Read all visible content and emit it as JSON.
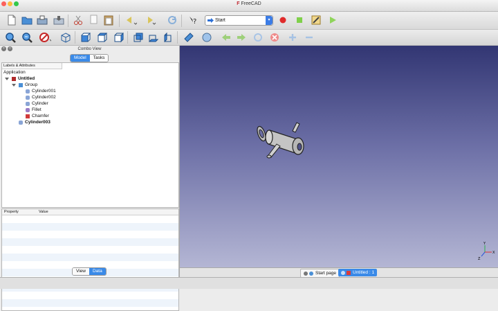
{
  "window": {
    "title": "FreeCAD",
    "controls": {
      "close_color": "#fc605b",
      "minimize_color": "#fdbc40",
      "zoom_color": "#34c84a"
    }
  },
  "toolbar": {
    "workbench": "Start",
    "icons_row1": [
      "new-file-icon",
      "open-folder-icon",
      "save-icon",
      "save-as-icon",
      "cut-icon",
      "copy-icon",
      "paste-icon",
      "undo-icon",
      "redo-icon",
      "refresh-icon",
      "whats-this-icon",
      "macro-record-icon",
      "macro-stop-icon",
      "macro-edit-icon",
      "macro-run-icon"
    ],
    "icons_row2": [
      "fit-all-icon",
      "fit-selection-icon",
      "draw-style-icon",
      "view-isometric-icon",
      "view-front-icon",
      "view-top-icon",
      "view-right-icon",
      "view-rear-icon",
      "view-bottom-icon",
      "view-left-icon",
      "measure-icon",
      "web-home-icon",
      "web-back-icon",
      "web-forward-icon",
      "web-refresh-icon",
      "web-stop-icon",
      "web-zoom-in-icon",
      "web-zoom-out-icon"
    ]
  },
  "combo_view": {
    "title": "Combo View",
    "tabs": [
      "Model",
      "Tasks"
    ],
    "active_tab": "Model",
    "labels_header": "Labels & Attributes",
    "application_label": "Application",
    "tree": [
      {
        "label": "Untitled",
        "level": 0,
        "bold": true,
        "icon": "document-icon",
        "expanded": true
      },
      {
        "label": "Group",
        "level": 1,
        "bold": false,
        "icon": "folder-icon",
        "expanded": true
      },
      {
        "label": "Cylinder001",
        "level": 2,
        "bold": false,
        "icon": "cylinder-icon"
      },
      {
        "label": "Cylinder002",
        "level": 2,
        "bold": false,
        "icon": "cylinder-icon"
      },
      {
        "label": "Cylinder",
        "level": 2,
        "bold": false,
        "icon": "cylinder-icon"
      },
      {
        "label": "Fillet",
        "level": 2,
        "bold": false,
        "icon": "fillet-icon"
      },
      {
        "label": "Chamfer",
        "level": 2,
        "bold": false,
        "icon": "chamfer-icon"
      },
      {
        "label": "Cylinder003",
        "level": 1,
        "bold": true,
        "icon": "cylinder-icon"
      }
    ],
    "property_headers": [
      "Property",
      "Value"
    ],
    "bottom_tabs": [
      "View",
      "Data"
    ],
    "active_bottom_tab": "Data"
  },
  "view_tabs": [
    {
      "label": "Start page",
      "active": false
    },
    {
      "label": "Untitled : 1",
      "active": true
    }
  ],
  "colors": {
    "accent": "#3a8ae8",
    "view_top": "#323673",
    "view_bottom": "#b4b6d4"
  }
}
